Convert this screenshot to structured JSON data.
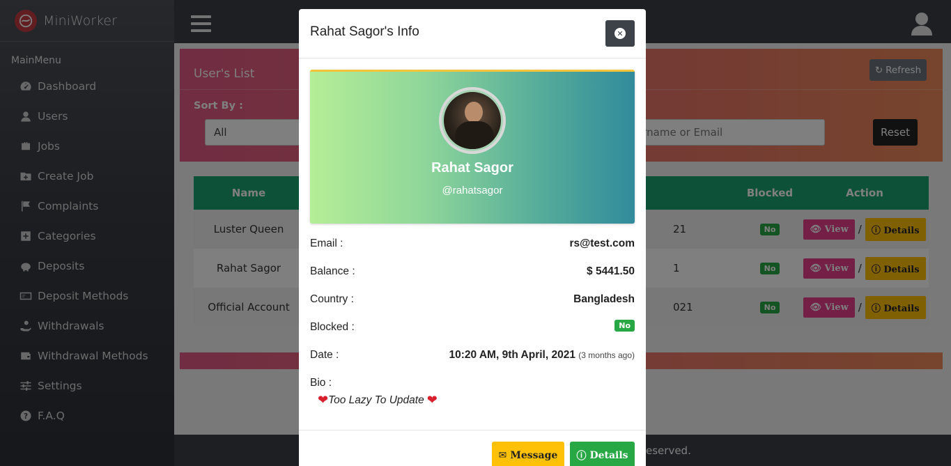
{
  "app": {
    "name": "MiniWorker"
  },
  "sidebar": {
    "menu_title": "MainMenu",
    "items": [
      {
        "label": "Dashboard",
        "icon": "dashboard-icon"
      },
      {
        "label": "Users",
        "icon": "users-icon"
      },
      {
        "label": "Jobs",
        "icon": "briefcase-icon"
      },
      {
        "label": "Create Job",
        "icon": "folder-plus-icon"
      },
      {
        "label": "Complaints",
        "icon": "flag-icon"
      },
      {
        "label": "Categories",
        "icon": "plus-square-icon"
      },
      {
        "label": "Deposits",
        "icon": "piggy-bank-icon"
      },
      {
        "label": "Deposit Methods",
        "icon": "money-bill-icon"
      },
      {
        "label": "Withdrawals",
        "icon": "hand-holding-icon"
      },
      {
        "label": "Withdrawal Methods",
        "icon": "wallet-icon"
      },
      {
        "label": "Settings",
        "icon": "sliders-icon"
      },
      {
        "label": "F.A.Q",
        "icon": "question-circle-icon"
      }
    ]
  },
  "page": {
    "list_title": "User's List",
    "refresh_label": "Refresh",
    "sort_label": "Sort By :",
    "sort_value": "All",
    "search_placeholder": "ername or Email",
    "reset_label": "Reset",
    "table": {
      "headers": {
        "name": "Name",
        "blocked": "Blocked",
        "action": "Action"
      },
      "rows": [
        {
          "name": "Luster Queen",
          "date_fragment": "21",
          "blocked": "No"
        },
        {
          "name": "Rahat Sagor",
          "date_fragment": "1",
          "blocked": "No"
        },
        {
          "name": "Official Account",
          "date_fragment": "021",
          "blocked": "No"
        }
      ],
      "view_label": "View",
      "details_label": "Details",
      "separator": "/"
    },
    "footer_text": "eserved."
  },
  "modal": {
    "title": "Rahat Sagor's Info",
    "close_icon": "close-circle-icon",
    "profile": {
      "name": "Rahat Sagor",
      "username": "@rahatsagor"
    },
    "fields": {
      "email_label": "Email :",
      "email_value": "rs@test.com",
      "balance_label": "Balance :",
      "balance_value": "$ 5441.50",
      "country_label": "Country :",
      "country_value": "Bangladesh",
      "blocked_label": "Blocked :",
      "blocked_value": "No",
      "date_label": "Date :",
      "date_value": "10:20 AM, 9th April, 2021",
      "date_relative": "(3 months ago)",
      "bio_label": "Bio :",
      "bio_value": "Too Lazy To Update"
    },
    "message_label": "Message",
    "details_label": "Details"
  },
  "colors": {
    "accent_green": "#1aa271",
    "badge_green": "#28a745",
    "view_pink": "#e83e8c",
    "details_yellow": "#ffc107",
    "header_gradient_start": "#e25a86",
    "header_gradient_end": "#ee8a5a"
  }
}
